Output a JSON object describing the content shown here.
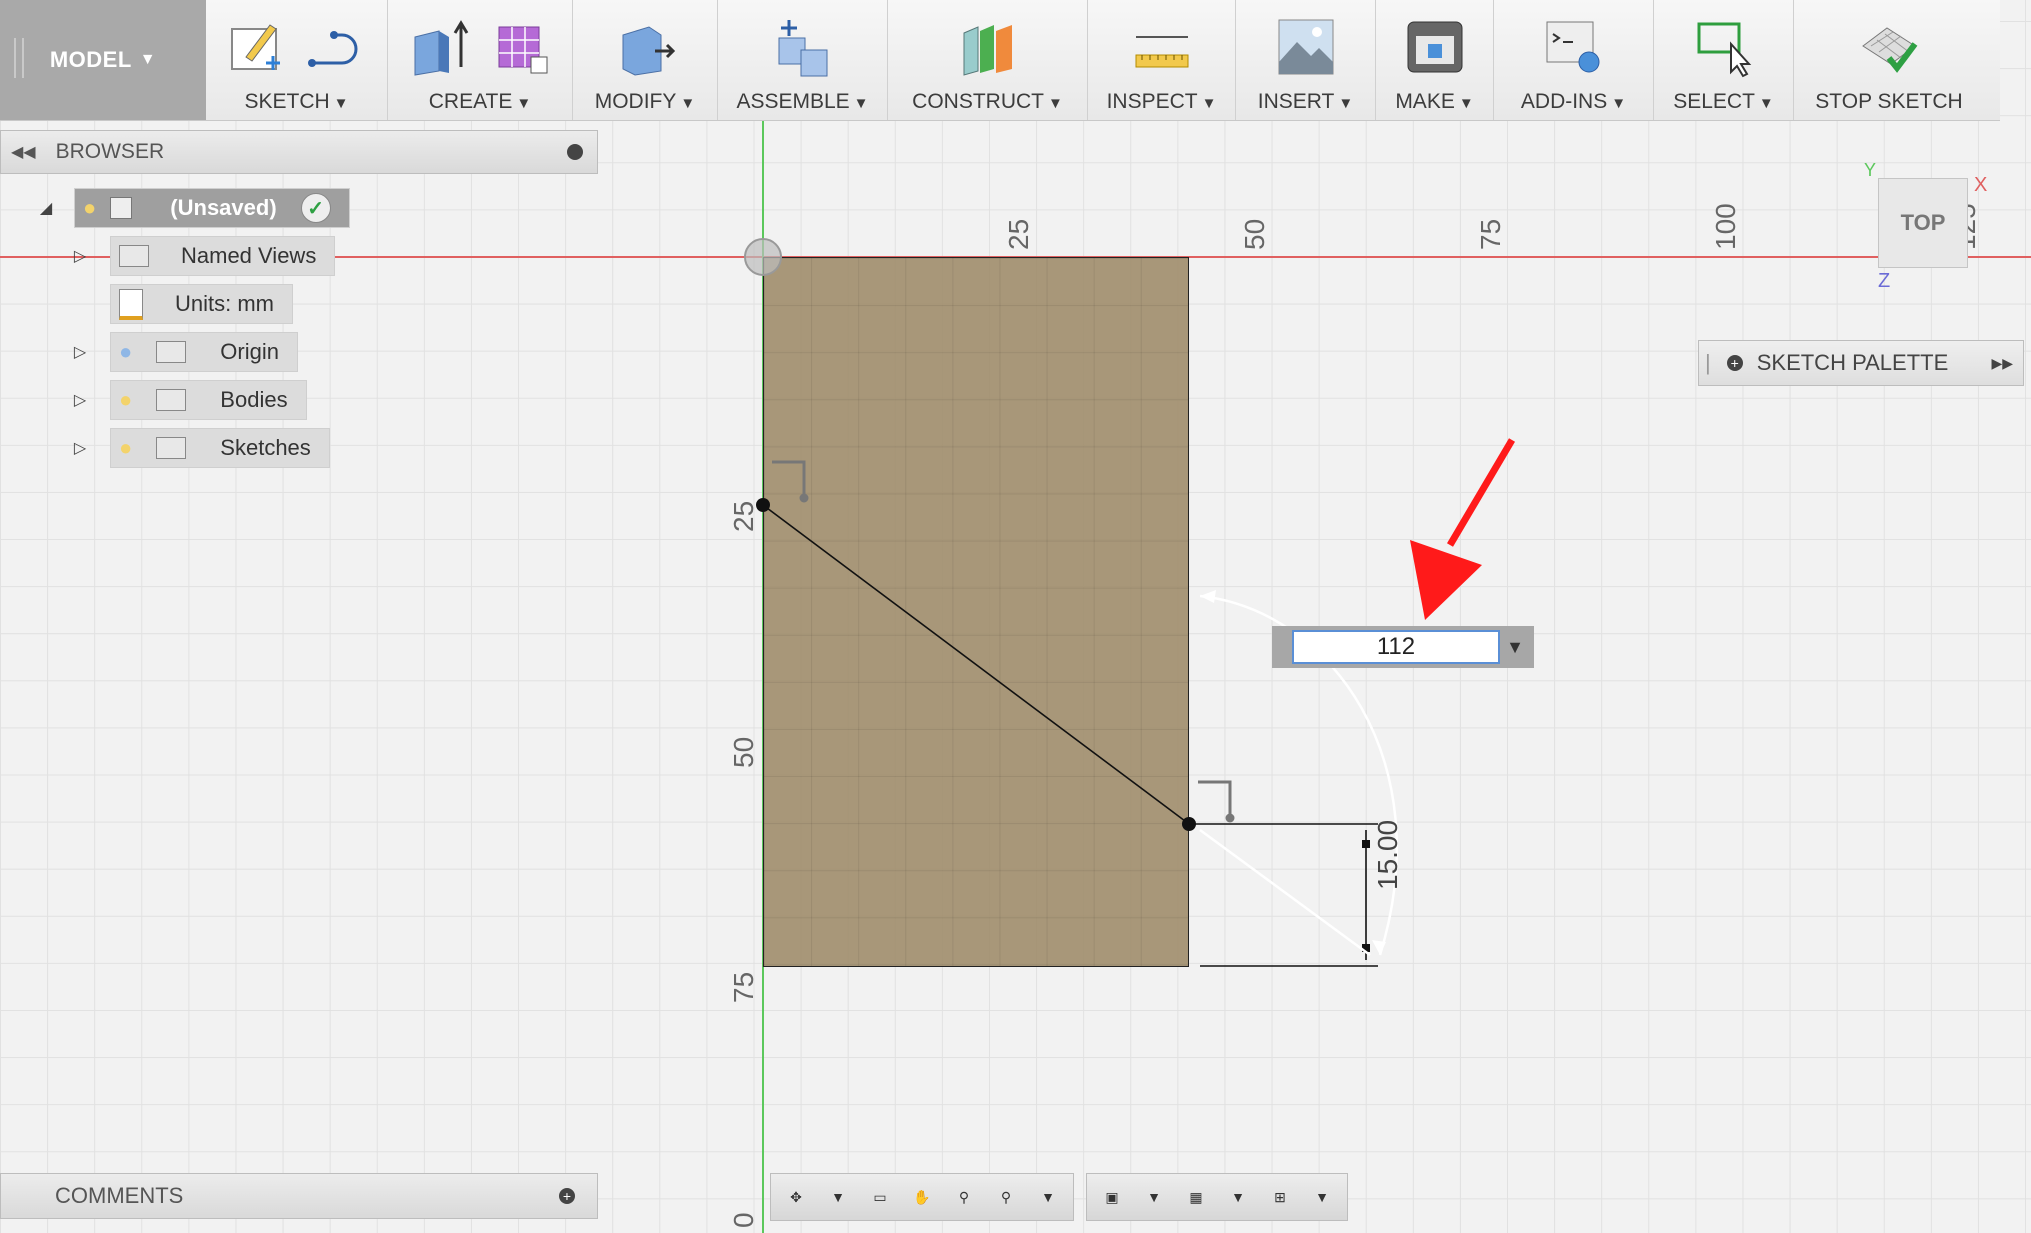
{
  "toolbar": {
    "mode": "MODEL",
    "groups": [
      {
        "label": "SKETCH"
      },
      {
        "label": "CREATE"
      },
      {
        "label": "MODIFY"
      },
      {
        "label": "ASSEMBLE"
      },
      {
        "label": "CONSTRUCT"
      },
      {
        "label": "INSPECT"
      },
      {
        "label": "INSERT"
      },
      {
        "label": "MAKE"
      },
      {
        "label": "ADD-INS"
      },
      {
        "label": "SELECT"
      },
      {
        "label": "STOP SKETCH"
      }
    ]
  },
  "browser": {
    "title": "BROWSER",
    "items": [
      {
        "label": "(Unsaved)"
      },
      {
        "label": "Named Views"
      },
      {
        "label": "Units: mm"
      },
      {
        "label": "Origin"
      },
      {
        "label": "Bodies"
      },
      {
        "label": "Sketches"
      }
    ]
  },
  "rulers": {
    "top": [
      "25",
      "50",
      "75",
      "100",
      "125"
    ],
    "left": [
      "25",
      "50",
      "75",
      "0"
    ]
  },
  "sketch": {
    "dimension_label": "15.00",
    "input_value": "112"
  },
  "viewcube": {
    "face": "TOP",
    "x": "X",
    "y": "Y",
    "z": "Z"
  },
  "palette": {
    "title": "SKETCH PALETTE"
  },
  "comments": {
    "title": "COMMENTS"
  },
  "colors": {
    "axis_x": "#e06060",
    "axis_y": "#5cc85c",
    "body": "#9b8764",
    "arrow": "#ff1a1a"
  }
}
